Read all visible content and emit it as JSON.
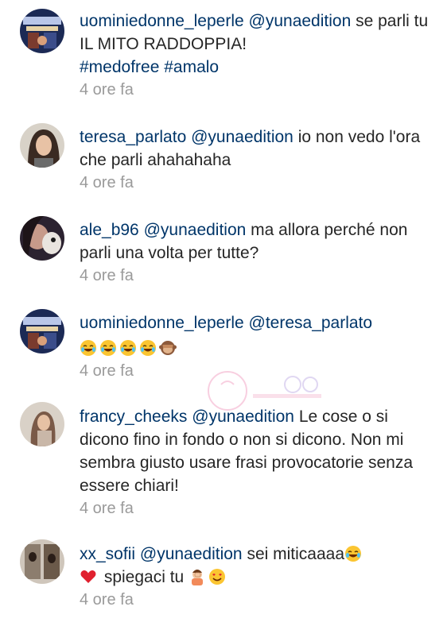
{
  "comments": [
    {
      "username": "uominiedonne_leperle",
      "mention": "@yunaedition",
      "text": " se parli tu IL MITO RADDOPPIA!",
      "hashtags": "#medofree #amalo",
      "time": "4 ore fa"
    },
    {
      "username": "teresa_parlato",
      "mention": "@yunaedition",
      "text": " io non vedo l'ora che parli ahahahaha",
      "time": "4 ore fa"
    },
    {
      "username": "ale_b96",
      "mention": "@yunaedition",
      "text": " ma allora perché non parli una volta per tutte?",
      "time": "4 ore fa"
    },
    {
      "username": "uominiedonne_leperle",
      "mention": "@teresa_parlato",
      "emojis": [
        "face-with-tears-of-joy-icon",
        "face-with-tears-of-joy-icon",
        "face-with-tears-of-joy-icon",
        "face-with-tears-of-joy-icon",
        "see-no-evil-monkey-icon"
      ],
      "time": "4 ore fa"
    },
    {
      "username": "francy_cheeks",
      "mention": "@yunaedition",
      "text": " Le cose o si dicono fino in fondo o non si dicono. Non mi sembra giusto usare frasi provocatorie senza essere chiari!",
      "time": "4 ore fa"
    },
    {
      "username": "xx_sofii",
      "mention": "@yunaedition",
      "text_a": "  sei miticaaaa",
      "text_b": " spiegaci tu ",
      "time": "4 ore fa"
    }
  ],
  "colors": {
    "username": "#003569",
    "link": "#003569",
    "text": "#262626",
    "time": "#9a9a9a"
  }
}
